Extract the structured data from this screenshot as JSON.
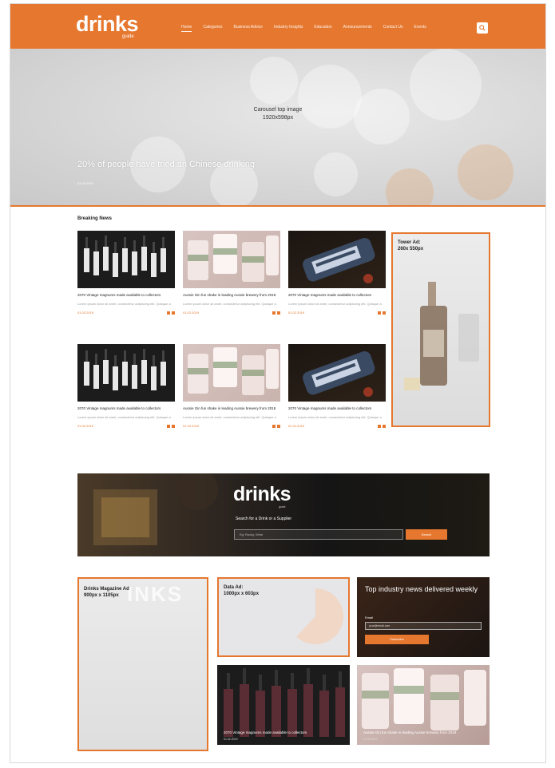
{
  "header": {
    "logo_text": "drinks",
    "logo_sub": "guide",
    "nav": [
      "Home",
      "Categories",
      "Business Advice",
      "Industry Insights",
      "Education",
      "Announcements",
      "Contact Us",
      "Events"
    ],
    "accent": "#e6772e"
  },
  "hero": {
    "label_line1": "Carousel top image",
    "label_line2": "1920x598px",
    "title": "20% of people have tried an Chinese drinking",
    "date": "01.02.2019"
  },
  "breaking_news": {
    "title": "Breaking News",
    "cards": [
      {
        "title": "2070 Vintage magnums made available to collectors",
        "excerpt": "Lorem ipsum dolor sit amet, consectetur adipiscing elit. Quisque a",
        "date": "01.02.2019"
      },
      {
        "title": "Aussie Gin fun shake in leading Aussie brewery from 2018",
        "excerpt": "Lorem ipsum dolor sit amet, consectetur adipiscing elit. Quisque a",
        "date": "01.02.2019"
      },
      {
        "title": "2070 Vintage magnums made available to collectors",
        "excerpt": "Lorem ipsum dolor sit amet, consectetur adipiscing elit. Quisque a",
        "date": "01.02.2019"
      },
      {
        "title": "2070 Vintage magnums made available to collectors",
        "excerpt": "Lorem ipsum dolor sit amet, consectetur adipiscing elit. Quisque a",
        "date": "01.02.2019"
      },
      {
        "title": "Aussie Gin fun shake in leading Aussie brewery from 2018",
        "excerpt": "Lorem ipsum dolor sit amet, consectetur adipiscing elit. Quisque a",
        "date": "01.02.2019"
      },
      {
        "title": "2070 Vintage magnums made available to collectors",
        "excerpt": "Lorem ipsum dolor sit amet, consectetur adipiscing elit. Quisque a",
        "date": "01.02.2019"
      }
    ]
  },
  "tower_ad": {
    "line1": "Tower Ad:",
    "line2": "260x 550px"
  },
  "banner": {
    "logo_text": "drinks",
    "logo_sub": "guide",
    "tagline": "Search for a Drink or a Supplier",
    "input_placeholder": "Eg: Rocky, Wine",
    "button": "Search"
  },
  "mag_ad": {
    "line1": "Drinks Magazine Ad",
    "line2": "900px x 1105px",
    "ghost": "INKS"
  },
  "data_ad": {
    "line1": "Data Ad:",
    "line2": "1000px x 603px"
  },
  "newsletter": {
    "heading": "Top industry news delivered weekly",
    "email_label": "Email",
    "email_placeholder": "your@email.com",
    "button": "Subscribe"
  },
  "tiles": [
    {
      "caption": "2070 Vintage magnums made available to collectors",
      "date": "01.02.2019"
    },
    {
      "caption": "Aussie Gin fun shake in leading Aussie brewery from 2018",
      "date": "01.02.2019"
    }
  ]
}
